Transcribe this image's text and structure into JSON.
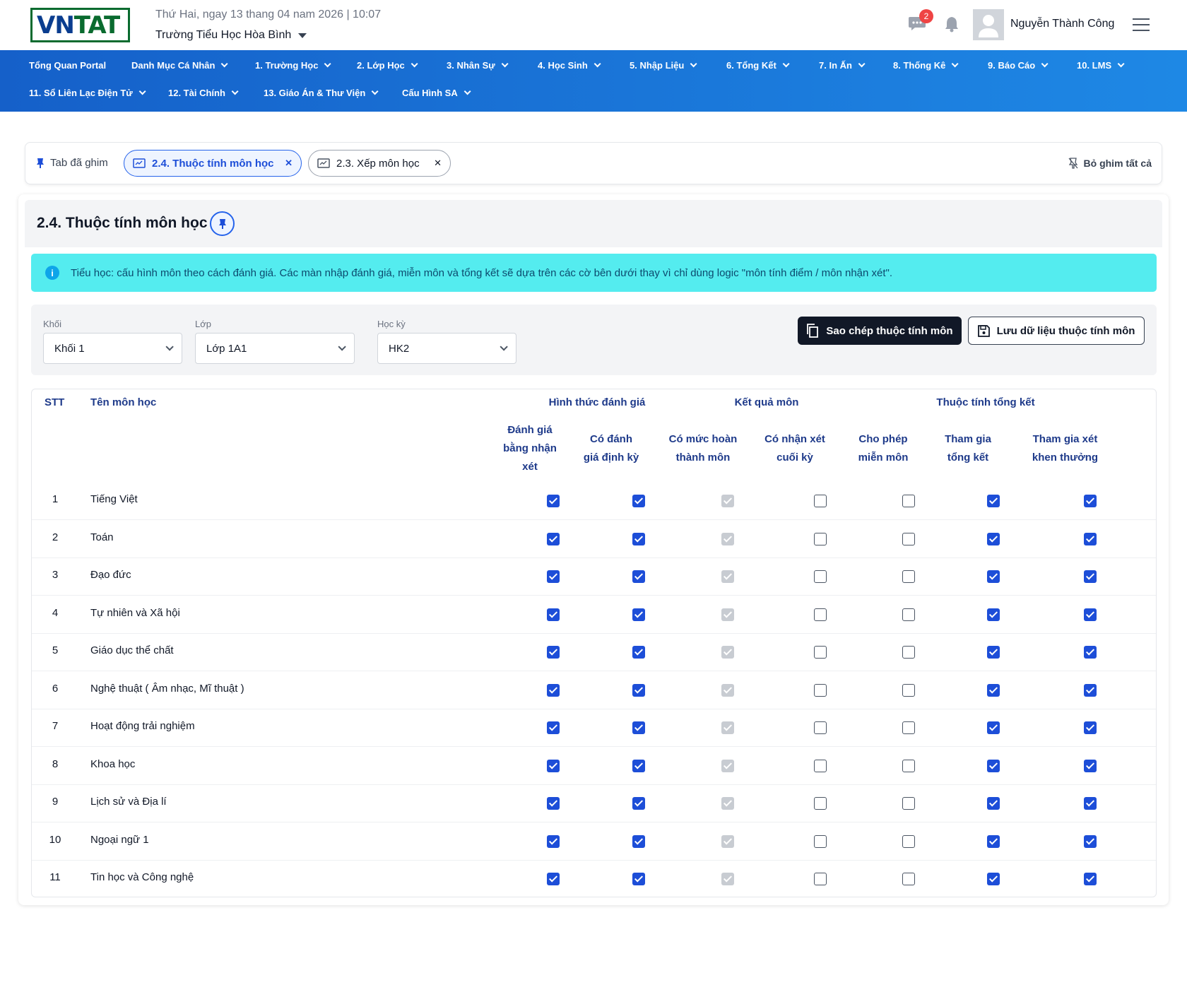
{
  "header": {
    "logo_left": "VN",
    "logo_right": "TAT",
    "date_line": "Thứ Hai, ngay 13 thang 04 nam 2026 | 10:07",
    "school": "Trường Tiểu Học Hòa Bình",
    "chat_badge": "2",
    "user_name": "Nguyễn Thành Công"
  },
  "nav": {
    "row1": [
      "Tổng Quan Portal",
      "Danh Mục Cá Nhân",
      "1. Trường Học",
      "2. Lớp Học",
      "3. Nhân Sự",
      "4. Học Sinh",
      "5. Nhập Liệu",
      "6. Tổng Kết",
      "7. In Ấn",
      "8. Thống Kê",
      "9. Báo Cáo",
      "10. LMS"
    ],
    "row2": [
      "11. Sổ Liên Lạc Điện Tử",
      "12. Tài Chính",
      "13. Giáo Án & Thư Viện",
      "Cấu Hình SA"
    ]
  },
  "pinbar": {
    "label": "Tab đã ghim",
    "tabs": [
      {
        "label": "2.4. Thuộc tính môn học"
      },
      {
        "label": "2.3. Xếp môn học"
      }
    ],
    "unpin_all": "Bỏ ghim tất cả"
  },
  "page": {
    "title": "2.4. Thuộc tính môn học",
    "alert": "Tiểu học: cấu hình môn theo cách đánh giá. Các màn nhập đánh giá, miễn môn và tổng kết sẽ dựa trên các cờ bên dưới thay vì chỉ dùng logic \"môn tính điểm / môn nhận xét\"."
  },
  "filters": {
    "khoi": {
      "label": "Khối",
      "value": "Khối 1"
    },
    "lop": {
      "label": "Lớp",
      "value": "Lớp 1A1"
    },
    "hocky": {
      "label": "Học kỳ",
      "value": "HK2"
    },
    "copy_button": "Sao chép thuộc tính môn",
    "save_button": "Lưu dữ liệu thuộc tính môn"
  },
  "table": {
    "stt_header": "STT",
    "name_header": "Tên môn học",
    "groups": [
      "Hình thức đánh giá",
      "Kết quả môn",
      "Thuộc tính tổng kết"
    ],
    "columns": [
      [
        "Đánh giá",
        "bằng nhận",
        "xét"
      ],
      [
        "Có đánh",
        "giá định kỳ"
      ],
      [
        "Có mức hoàn",
        "thành môn"
      ],
      [
        "Có nhận xét",
        "cuối kỳ"
      ],
      [
        "Cho phép",
        "miễn môn"
      ],
      [
        "Tham gia",
        "tổng kết"
      ],
      [
        "Tham gia xét",
        "khen thưởng"
      ]
    ],
    "rows": [
      {
        "stt": "1",
        "name": "Tiếng Việt",
        "flags": [
          "on",
          "on",
          "dis",
          "off",
          "off",
          "on",
          "on"
        ]
      },
      {
        "stt": "2",
        "name": "Toán",
        "flags": [
          "on",
          "on",
          "dis",
          "off",
          "off",
          "on",
          "on"
        ]
      },
      {
        "stt": "3",
        "name": "Đạo đức",
        "flags": [
          "on",
          "on",
          "dis",
          "off",
          "off",
          "on",
          "on"
        ]
      },
      {
        "stt": "4",
        "name": "Tự nhiên và Xã hội",
        "flags": [
          "on",
          "on",
          "dis",
          "off",
          "off",
          "on",
          "on"
        ]
      },
      {
        "stt": "5",
        "name": "Giáo dục thể chất",
        "flags": [
          "on",
          "on",
          "dis",
          "off",
          "off",
          "on",
          "on"
        ]
      },
      {
        "stt": "6",
        "name": "Nghệ thuật ( Âm nhạc, Mĩ thuật )",
        "flags": [
          "on",
          "on",
          "dis",
          "off",
          "off",
          "on",
          "on"
        ]
      },
      {
        "stt": "7",
        "name": "Hoạt động trải nghiệm",
        "flags": [
          "on",
          "on",
          "dis",
          "off",
          "off",
          "on",
          "on"
        ]
      },
      {
        "stt": "8",
        "name": "Khoa học",
        "flags": [
          "on",
          "on",
          "dis",
          "off",
          "off",
          "on",
          "on"
        ]
      },
      {
        "stt": "9",
        "name": "Lịch sử và Địa lí",
        "flags": [
          "on",
          "on",
          "dis",
          "off",
          "off",
          "on",
          "on"
        ]
      },
      {
        "stt": "10",
        "name": "Ngoại ngữ 1",
        "flags": [
          "on",
          "on",
          "dis",
          "off",
          "off",
          "on",
          "on"
        ]
      },
      {
        "stt": "11",
        "name": "Tin học và Công nghệ",
        "flags": [
          "on",
          "on",
          "dis",
          "off",
          "off",
          "on",
          "on"
        ]
      }
    ]
  }
}
